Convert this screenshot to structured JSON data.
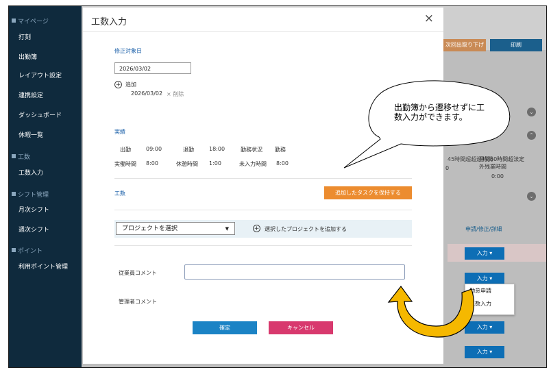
{
  "sidebar": {
    "sections": [
      {
        "label": "マイページ",
        "items": [
          "打刻",
          "出勤簿",
          "レイアウト設定",
          "連携設定",
          "ダッシュボード",
          "休暇一覧"
        ]
      },
      {
        "label": "工数",
        "items": [
          "工数入力"
        ]
      },
      {
        "label": "シフト管理",
        "items": [
          "月次シフト",
          "週次シフト"
        ]
      },
      {
        "label": "ポイント",
        "items": [
          "利用ポイント管理"
        ]
      }
    ]
  },
  "background": {
    "btn_withdraw": "次回出取り下げ",
    "btn_print": "印刷",
    "col1_line1": "45時間超超過時間",
    "col2_line1": "月間60時間超法定",
    "col2_line2": "外残業時間",
    "col1_value": "0",
    "col2_value": "0:00",
    "col_header": "申請/修正/詳細",
    "row_button": "入力",
    "dropdown_items": [
      "勤怠申請",
      "工数入力"
    ]
  },
  "dialog": {
    "title": "工数入力",
    "close_glyph": "×",
    "target_date_label": "修正対象日",
    "date_value": "2026/03/02",
    "add_label": "追加",
    "added_date": "2026/03/02",
    "delete_label": "× 削除",
    "results_label": "実績",
    "results": [
      {
        "label": "出勤",
        "value": "09:00"
      },
      {
        "label": "退勤",
        "value": "18:00"
      },
      {
        "label": "勤務状況",
        "value": "勤務"
      },
      {
        "label": "実働時間",
        "value": "8:00"
      },
      {
        "label": "休憩時間",
        "value": "1:00"
      },
      {
        "label": "未入力時間",
        "value": "8:00"
      }
    ],
    "kosu_label": "工数",
    "keep_task_button": "追加したタスクを保持する",
    "project_select": "プロジェクトを選択",
    "add_project": "選択したプロジェクトを追加する",
    "employee_comment": "従業員コメント",
    "manager_comment": "管理者コメント",
    "confirm": "確定",
    "cancel": "キャンセル"
  },
  "callout": {
    "text": "出勤簿から遷移せずに工数入力ができます。"
  },
  "colors": {
    "sidebar": "#0f2a3d",
    "accent_blue": "#1b83c5",
    "orange": "#ec8c2f",
    "pink": "#d8396e",
    "arrow": "#f5b800"
  }
}
